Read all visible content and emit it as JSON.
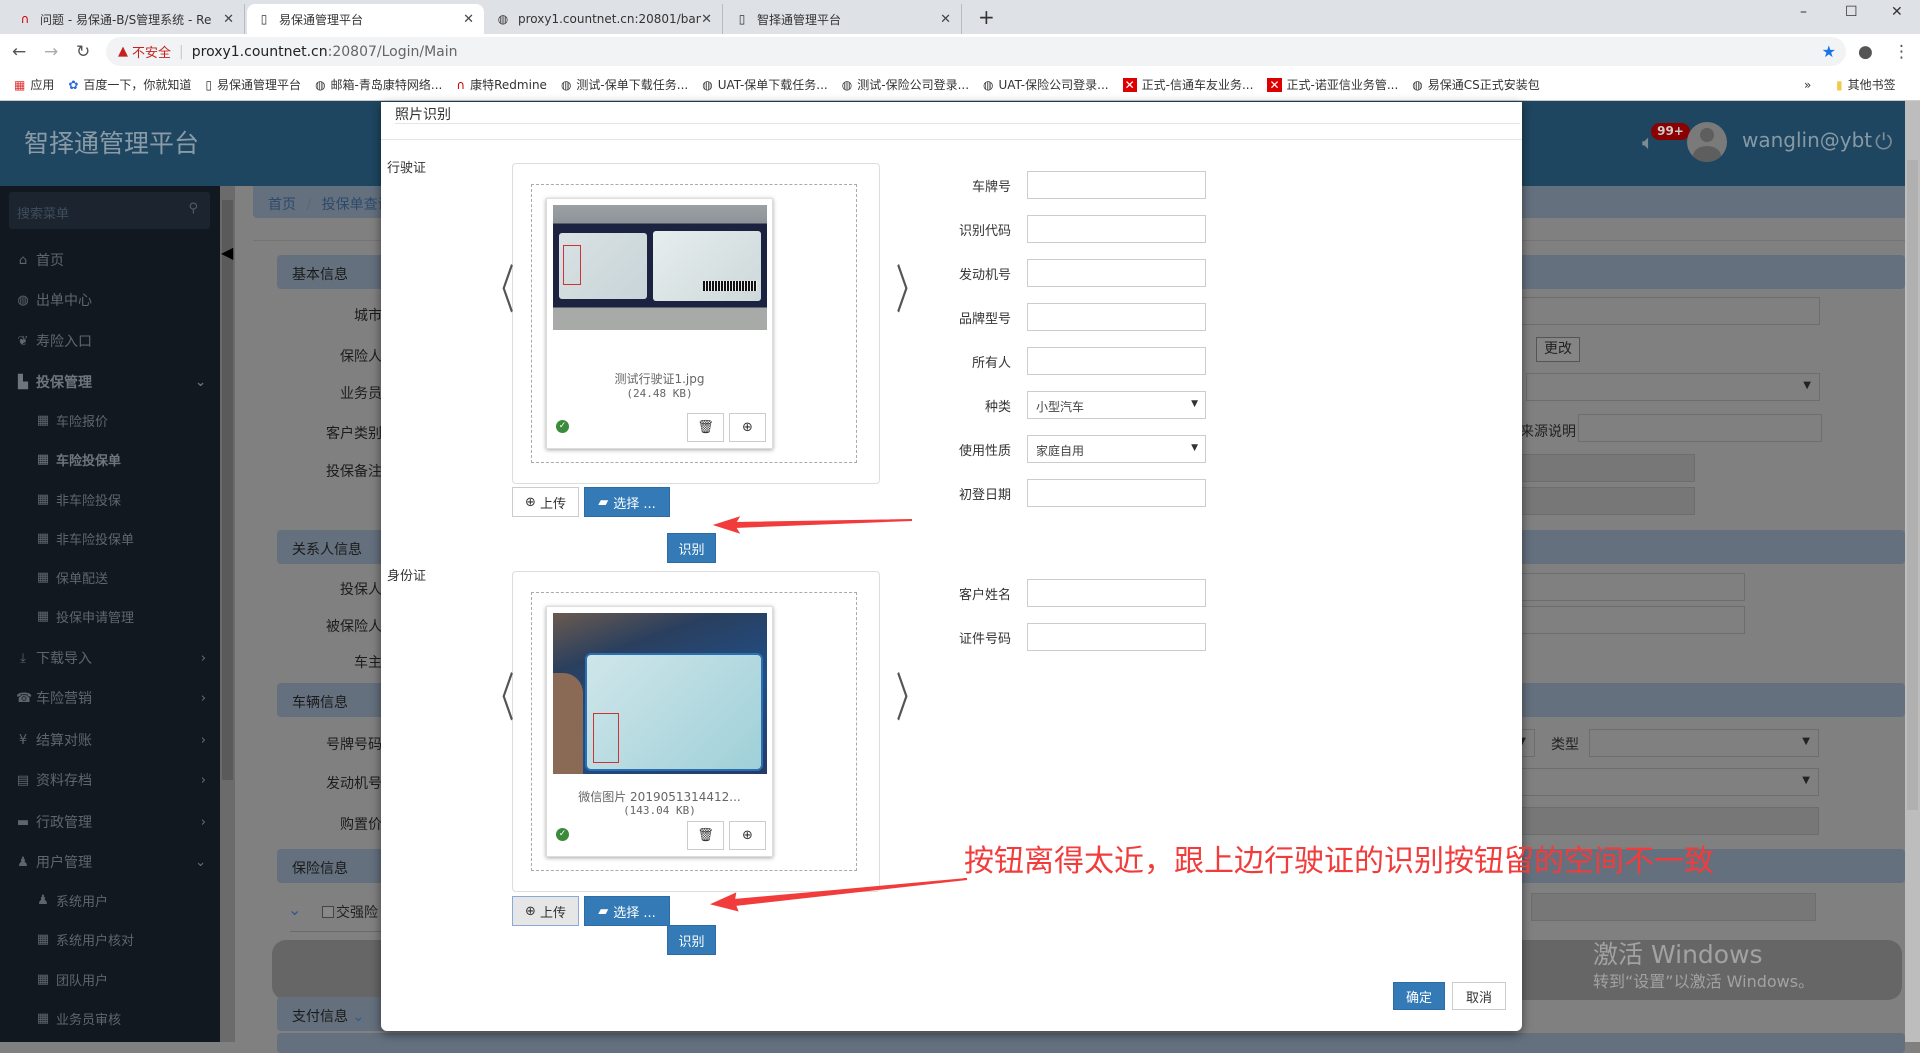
{
  "browser": {
    "tabs": [
      {
        "label": "问题 - 易保通-B/S管理系统 - Re",
        "icon": "redmine-icon"
      },
      {
        "label": "易保通管理平台",
        "icon": "page-icon",
        "active": true
      },
      {
        "label": "proxy1.countnet.cn:20801/ban",
        "icon": "globe-icon"
      },
      {
        "label": "智择通管理平台",
        "icon": "page-icon"
      }
    ],
    "new_tab": "+",
    "window_controls": {
      "minimize": "–",
      "maximize": "☐",
      "close": "✕"
    },
    "security_label": "不安全",
    "url_host": "proxy1.countnet.cn",
    "url_rest": ":20807/Login/Main",
    "bookmarks": [
      {
        "label": "应用",
        "icon": "apps-icon"
      },
      {
        "label": "百度一下，你就知道",
        "icon": "baidu-icon"
      },
      {
        "label": "易保通管理平台",
        "icon": "page-icon"
      },
      {
        "label": "邮箱-青岛康特网络...",
        "icon": "globe-icon"
      },
      {
        "label": "康特Redmine",
        "icon": "redmine-icon"
      },
      {
        "label": "测试-保单下载任务...",
        "icon": "globe-icon"
      },
      {
        "label": "UAT-保单下载任务...",
        "icon": "globe-icon"
      },
      {
        "label": "测试-保险公司登录...",
        "icon": "globe-icon"
      },
      {
        "label": "UAT-保险公司登录...",
        "icon": "globe-icon"
      },
      {
        "label": "正式-信通车友业务...",
        "icon": "error-icon"
      },
      {
        "label": "正式-诺亚信业务管...",
        "icon": "error-icon"
      },
      {
        "label": "易保通CS正式安装包",
        "icon": "globe-icon"
      }
    ],
    "more": "»",
    "other_bookmarks": "其他书签"
  },
  "app": {
    "title": "智择通管理平台",
    "badge": "99+",
    "username": "wanglin@ybt",
    "search_placeholder": "搜索菜单",
    "breadcrumb": [
      "首页",
      "/",
      "投保单查询"
    ],
    "sidebar": [
      {
        "label": "首页",
        "icon": "⌂"
      },
      {
        "label": "出单中心",
        "icon": "◍"
      },
      {
        "label": "寿险入口",
        "icon": "❦"
      },
      {
        "label": "投保管理",
        "icon": "▙",
        "expanded": true
      },
      {
        "label": "车险报价",
        "icon": "▦"
      },
      {
        "label": "车险投保单",
        "icon": "▦",
        "active": true
      },
      {
        "label": "非车险投保",
        "icon": "▦"
      },
      {
        "label": "非车险投保单",
        "icon": "▦"
      },
      {
        "label": "保单配送",
        "icon": "▦"
      },
      {
        "label": "投保申请管理",
        "icon": "▦"
      },
      {
        "label": "下载导入",
        "icon": "⤓"
      },
      {
        "label": "车险营销",
        "icon": "☎"
      },
      {
        "label": "结算对账",
        "icon": "¥"
      },
      {
        "label": "资料存档",
        "icon": "▤"
      },
      {
        "label": "行政管理",
        "icon": "▬"
      },
      {
        "label": "用户管理",
        "icon": "♟",
        "expanded": true
      },
      {
        "label": "系统用户",
        "icon": "♟"
      },
      {
        "label": "系统用户核对",
        "icon": "▦"
      },
      {
        "label": "团队用户",
        "icon": "▦"
      },
      {
        "label": "业务员审核",
        "icon": "▦"
      }
    ],
    "sections": [
      "基本信息",
      "关系人信息",
      "车辆信息",
      "保险信息",
      "支付信息"
    ],
    "labels": [
      "城市",
      "保险人",
      "业务员",
      "客户类别",
      "投保备注",
      "投保人",
      "被保险人",
      "车主",
      "号牌号码",
      "发动机号",
      "购置价"
    ],
    "checkbox_label": "交强险",
    "change_button": "更改",
    "source_label": "来源说明",
    "type_label": "类型"
  },
  "modal": {
    "title": "照片识别",
    "vehicle": {
      "section_label": "行驶证",
      "file_name": "测试行驶证1.jpg",
      "file_size": "(24.48 KB)",
      "upload": "上传",
      "choose": "选择 ...",
      "recognize": "识别",
      "fields": [
        {
          "label": "车牌号",
          "value": ""
        },
        {
          "label": "识别代码",
          "value": ""
        },
        {
          "label": "发动机号",
          "value": ""
        },
        {
          "label": "品牌型号",
          "value": ""
        },
        {
          "label": "所有人",
          "value": ""
        },
        {
          "label": "种类",
          "value": "小型汽车",
          "type": "select"
        },
        {
          "label": "使用性质",
          "value": "家庭自用",
          "type": "select"
        },
        {
          "label": "初登日期",
          "value": ""
        }
      ]
    },
    "id_card": {
      "section_label": "身份证",
      "file_name": "微信图片 2019051314412...",
      "file_size": "(143.04 KB)",
      "upload": "上传",
      "choose": "选择 ...",
      "recognize": "识别",
      "fields": [
        {
          "label": "客户姓名",
          "value": ""
        },
        {
          "label": "证件号码",
          "value": ""
        }
      ]
    },
    "confirm": "确定",
    "cancel": "取消"
  },
  "annotation": {
    "text": "按钮离得太近，跟上边行驶证的识别按钮留的空间不一致",
    "color": "#f23c3c"
  },
  "watermark": {
    "line1": "激活 Windows",
    "line2": "转到“设置”以激活 Windows。"
  },
  "colors": {
    "header": "#1e4660",
    "sidebar": "#111820",
    "primary": "#337ab7",
    "badge": "#8b0000"
  }
}
